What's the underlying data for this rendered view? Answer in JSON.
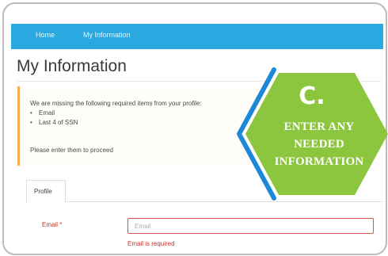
{
  "nav": {
    "links": [
      "Home",
      "My Information"
    ]
  },
  "page_title": "My Information",
  "alert": {
    "intro": "We are missing the following required items from your profile:",
    "items": [
      "Email",
      "Last 4 of SSN"
    ],
    "footer": "Please enter them to proceed"
  },
  "tabs": [
    "Profile"
  ],
  "form": {
    "email_label": "Email *",
    "email_placeholder": "Email",
    "email_value": "",
    "email_error": "Email is required"
  },
  "callout": {
    "letter": "C.",
    "lines": [
      "ENTER ANY",
      "NEEDED",
      "INFORMATION"
    ]
  },
  "colors": {
    "navbar": "#2aa8e0",
    "callout_green": "#8cc63f",
    "callout_blue": "#1e88d8",
    "alert_border": "#f0ad4e",
    "error": "#d9534f"
  }
}
